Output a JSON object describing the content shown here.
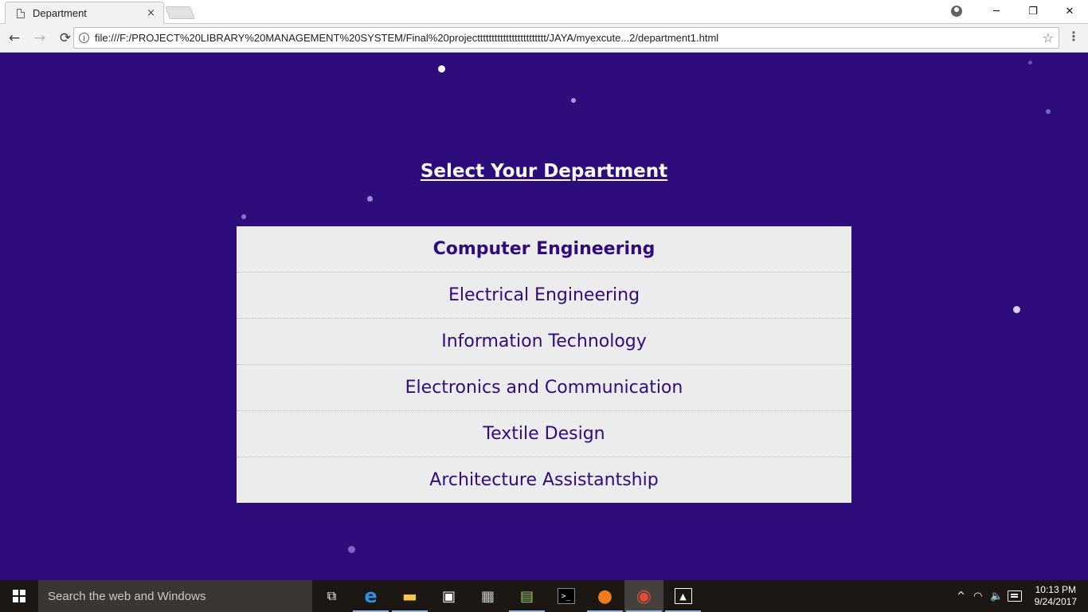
{
  "browser": {
    "tab_title": "Department",
    "tab_close": "×",
    "url": "file:///F:/PROJECT%20LIBRARY%20MANAGEMENT%20SYSTEM/Final%20projectttttttttttttttttttttttt/JAYA/myexcute...2/department1.html",
    "window_controls": {
      "minimize": "─",
      "restore": "❐",
      "close": "✕"
    },
    "nav": {
      "back": "←",
      "forward": "→",
      "reload": "⟳"
    },
    "info_glyph": "i",
    "star_glyph": "☆",
    "menu_glyph": "⋮"
  },
  "page": {
    "title": "Select Your Department",
    "departments": [
      {
        "label": "Computer Engineering"
      },
      {
        "label": "Electrical Engineering"
      },
      {
        "label": "Information Technology"
      },
      {
        "label": "Electronics and Communication"
      },
      {
        "label": "Textile Design"
      },
      {
        "label": "Architecture Assistantship"
      }
    ],
    "colors": {
      "background": "#2f0c7c",
      "list_bg": "#ececec",
      "item_text": "#2f0c7c",
      "title_text": "#ffffff"
    }
  },
  "taskbar": {
    "search_placeholder": "Search the web and Windows",
    "apps": [
      {
        "name": "task-view-icon",
        "glyph": "⧉"
      },
      {
        "name": "edge-icon",
        "glyph": "e"
      },
      {
        "name": "file-explorer-icon",
        "glyph": "▬"
      },
      {
        "name": "store-icon",
        "glyph": "▣"
      },
      {
        "name": "network-app-icon",
        "glyph": "▦"
      },
      {
        "name": "chart-app-icon",
        "glyph": "▤"
      },
      {
        "name": "cmd-icon",
        "glyph": ">_"
      },
      {
        "name": "firefox-icon",
        "glyph": "●"
      },
      {
        "name": "chrome-icon",
        "glyph": "◉"
      },
      {
        "name": "photos-icon",
        "glyph": "▲"
      }
    ],
    "tray": {
      "chevron": "^",
      "wifi": "◠",
      "volume": "🔈"
    },
    "time": "10:13 PM",
    "date": "9/24/2017"
  }
}
